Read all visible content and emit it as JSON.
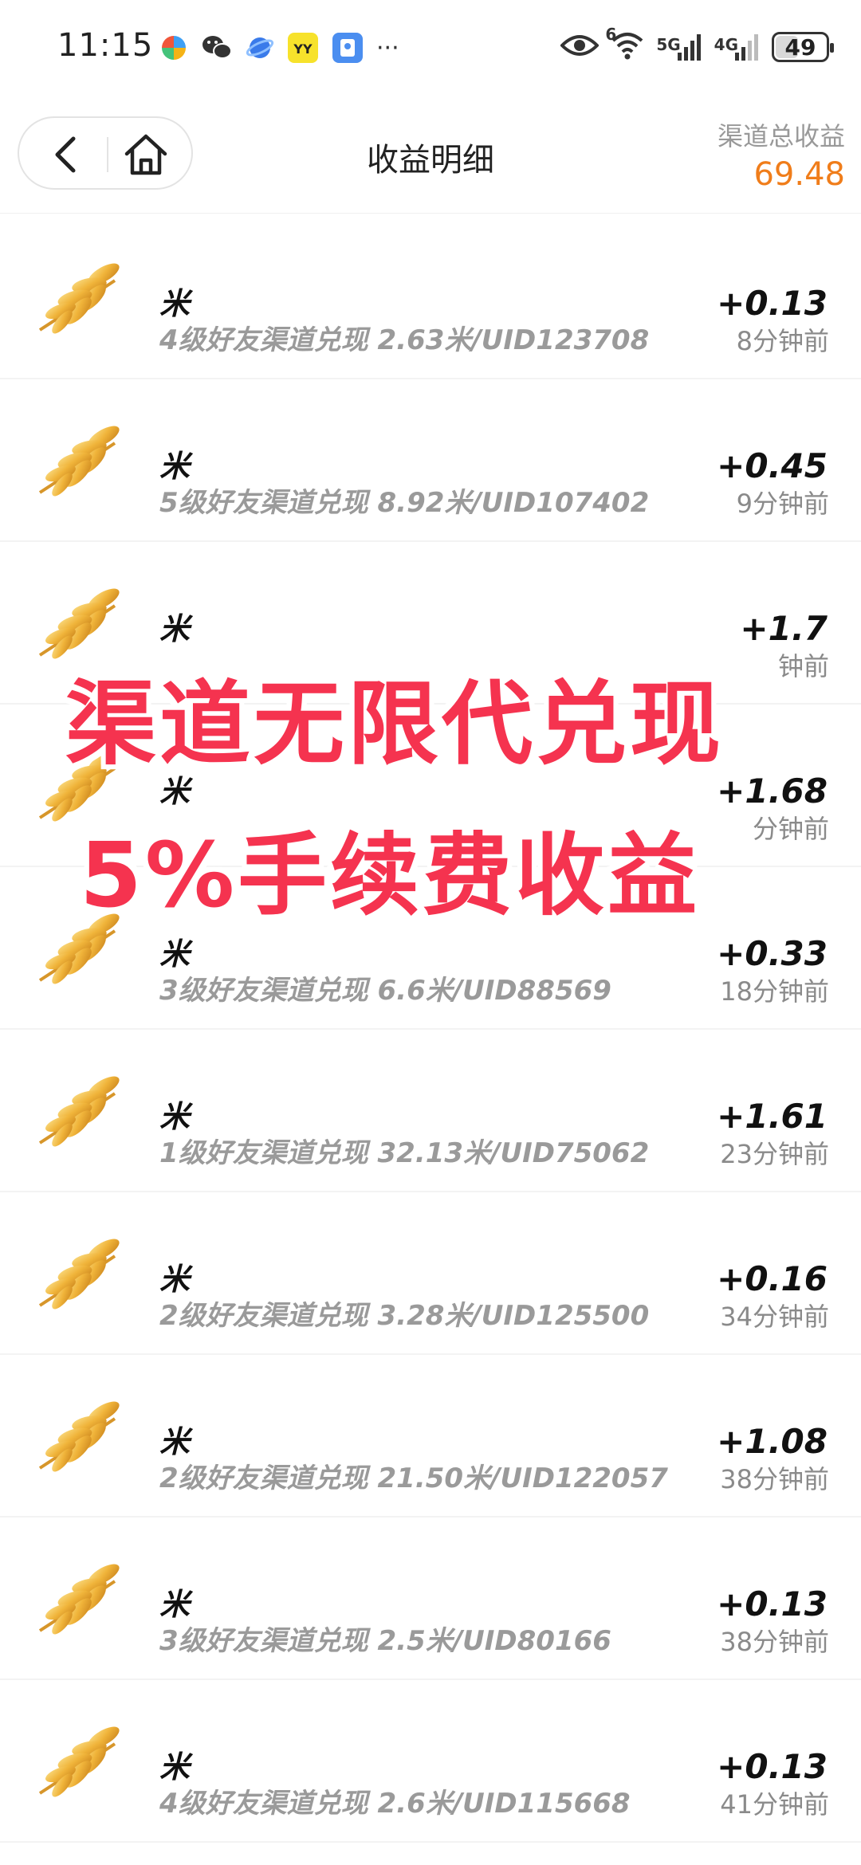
{
  "status_bar": {
    "time": "11:15",
    "app_icons": [
      "pinwheel-app-icon",
      "wechat-icon",
      "browser-planet-icon",
      "yy-app-icon",
      "blue-app-icon",
      "more-dots-icon"
    ],
    "yy_label": "YY",
    "more_label": "···",
    "wifi_sup": "6",
    "sig1_label": "5G",
    "sig2_label": "4G",
    "battery": "49",
    "battery_level": 0.49
  },
  "header": {
    "title": "收益明细",
    "total_label": "渠道总收益",
    "total_value": "69.48",
    "accent_color": "#f07d1a"
  },
  "items": [
    {
      "name": "米",
      "desc": "4级好友渠道兑现 2.63米/UID123708",
      "amount": "+0.13",
      "time": "8分钟前"
    },
    {
      "name": "米",
      "desc": "5级好友渠道兑现 8.92米/UID107402",
      "amount": "+0.45",
      "time": "9分钟前"
    },
    {
      "name": "米",
      "desc": "",
      "amount": "+1.7",
      "time": "钟前"
    },
    {
      "name": "米",
      "desc": "",
      "amount": "+1.68",
      "time": "分钟前"
    },
    {
      "name": "米",
      "desc": "3级好友渠道兑现 6.6米/UID88569",
      "amount": "+0.33",
      "time": "18分钟前"
    },
    {
      "name": "米",
      "desc": "1级好友渠道兑现 32.13米/UID75062",
      "amount": "+1.61",
      "time": "23分钟前"
    },
    {
      "name": "米",
      "desc": "2级好友渠道兑现 3.28米/UID125500",
      "amount": "+0.16",
      "time": "34分钟前"
    },
    {
      "name": "米",
      "desc": "2级好友渠道兑现 21.50米/UID122057",
      "amount": "+1.08",
      "time": "38分钟前"
    },
    {
      "name": "米",
      "desc": "3级好友渠道兑现 2.5米/UID80166",
      "amount": "+0.13",
      "time": "38分钟前"
    },
    {
      "name": "米",
      "desc": "4级好友渠道兑现 2.6米/UID115668",
      "amount": "+0.13",
      "time": "41分钟前"
    }
  ],
  "overlay": {
    "line1": "渠道无限代兑现",
    "line2": "5%手续费收益",
    "color": "#f5334f"
  }
}
